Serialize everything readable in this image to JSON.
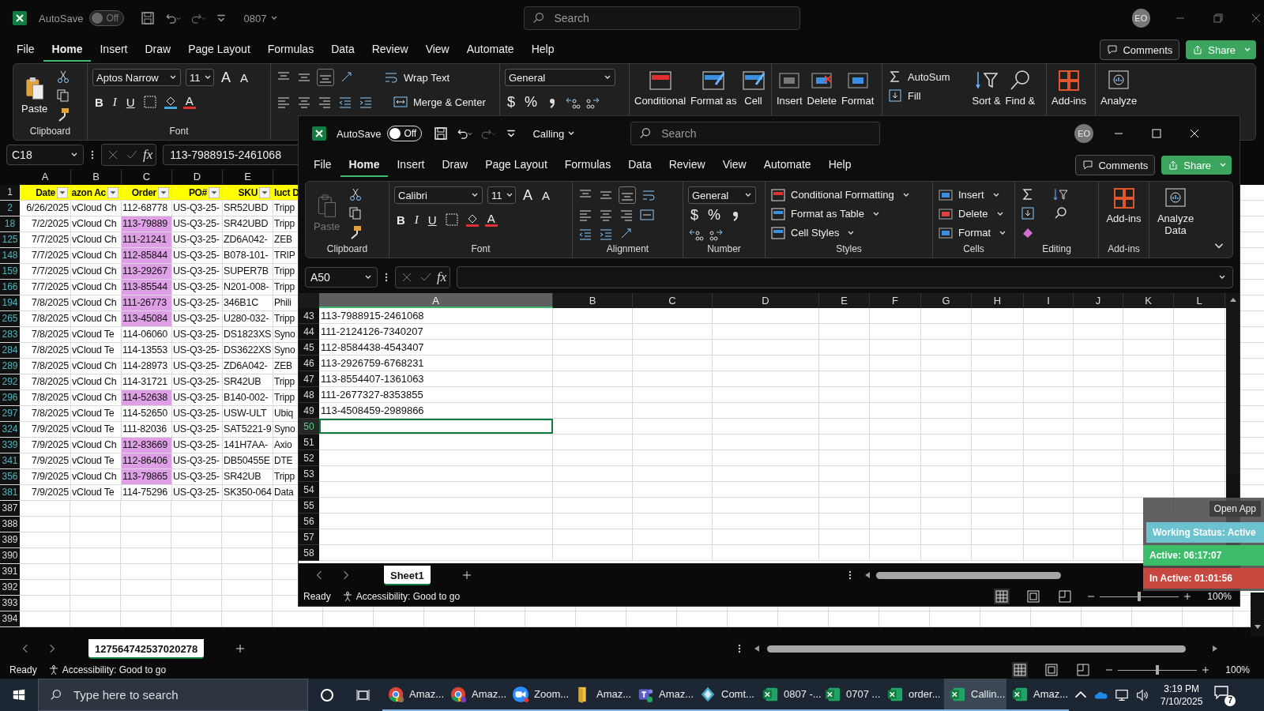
{
  "back_window": {
    "title_bar": {
      "autosave_label": "AutoSave",
      "autosave_on": false,
      "autosave_state": "Off",
      "file_name": "0807",
      "search_placeholder": "Search",
      "avatar": "EO"
    },
    "menu_tabs": [
      {
        "label": "File",
        "selected": false
      },
      {
        "label": "Home",
        "selected": true
      },
      {
        "label": "Insert",
        "selected": false
      },
      {
        "label": "Draw",
        "selected": false
      },
      {
        "label": "Page Layout",
        "selected": false
      },
      {
        "label": "Formulas",
        "selected": false
      },
      {
        "label": "Data",
        "selected": false
      },
      {
        "label": "Review",
        "selected": false
      },
      {
        "label": "View",
        "selected": false
      },
      {
        "label": "Automate",
        "selected": false
      },
      {
        "label": "Help",
        "selected": false
      }
    ],
    "comments": "Comments",
    "share": "Share",
    "ribbon": {
      "paste": "Paste",
      "clipboard_label": "Clipboard",
      "font_name": "Aptos Narrow",
      "font_size": "11",
      "grow_font": "A",
      "shrink_font": "A",
      "bold": "B",
      "italic": "I",
      "underline": "U",
      "font_color": "A",
      "font_label": "Font",
      "wrap_text": "Wrap Text",
      "merge_center": "Merge & Center",
      "number_format": "General",
      "currency": "$",
      "percent": "%",
      "styles": [
        "Conditional",
        "Format as",
        "Cell"
      ],
      "cells": [
        "Insert",
        "Delete",
        "Format"
      ],
      "autosum": "AutoSum",
      "fill": "Fill",
      "sort": "Sort &",
      "find": "Find &",
      "add_ins": "Add-ins",
      "analyze": "Analyze"
    },
    "name_box": "C18",
    "fx": "fx",
    "formula": "113-7988915-2461068",
    "columns": [
      "A",
      "B",
      "C",
      "D",
      "E"
    ],
    "header_row": {
      "number": "1",
      "cells": [
        "Date",
        "azon Ac",
        "Order",
        "PO#",
        "SKU",
        "luct D"
      ]
    },
    "rows": [
      {
        "number": "2",
        "filtered": true,
        "highlighted": false,
        "cells": [
          "6/26/2025",
          "vCloud Ch",
          "112-68778",
          "US-Q3-25-",
          "SR52UBD",
          "Tripp"
        ]
      },
      {
        "number": "18",
        "filtered": true,
        "highlighted": true,
        "cells": [
          "7/2/2025",
          "vCloud Ch",
          "113-79889",
          "US-Q3-25-",
          "SR42UBD",
          "Tripp"
        ]
      },
      {
        "number": "125",
        "filtered": true,
        "highlighted": true,
        "cells": [
          "7/7/2025",
          "vCloud Ch",
          "111-21241",
          "US-Q3-25-",
          "ZD6A042-",
          "ZEB"
        ]
      },
      {
        "number": "148",
        "filtered": true,
        "highlighted": true,
        "cells": [
          "7/7/2025",
          "vCloud Ch",
          "112-85844",
          "US-Q3-25-",
          "B078-101-",
          "TRIP"
        ]
      },
      {
        "number": "159",
        "filtered": true,
        "highlighted": true,
        "cells": [
          "7/7/2025",
          "vCloud Ch",
          "113-29267",
          "US-Q3-25-",
          "SUPER7B",
          "Tripp"
        ]
      },
      {
        "number": "166",
        "filtered": true,
        "highlighted": true,
        "cells": [
          "7/7/2025",
          "vCloud Ch",
          "113-85544",
          "US-Q3-25-",
          "N201-008-",
          "Tripp"
        ]
      },
      {
        "number": "194",
        "filtered": true,
        "highlighted": true,
        "cells": [
          "7/8/2025",
          "vCloud Ch",
          "111-26773",
          "US-Q3-25-",
          "346B1C",
          "Phili"
        ]
      },
      {
        "number": "265",
        "filtered": true,
        "highlighted": true,
        "cells": [
          "7/8/2025",
          "vCloud Ch",
          "113-45084",
          "US-Q3-25-",
          "U280-032-",
          "Tripp"
        ]
      },
      {
        "number": "283",
        "filtered": true,
        "highlighted": false,
        "cells": [
          "7/8/2025",
          "vCloud Te",
          "114-06060",
          "US-Q3-25-",
          "DS1823XS",
          "Syno"
        ]
      },
      {
        "number": "284",
        "filtered": true,
        "highlighted": false,
        "cells": [
          "7/8/2025",
          "vCloud Te",
          "114-13553",
          "US-Q3-25-",
          "DS3622XS",
          "Syno"
        ]
      },
      {
        "number": "289",
        "filtered": true,
        "highlighted": false,
        "cells": [
          "7/8/2025",
          "vCloud Ch",
          "114-28973",
          "US-Q3-25-",
          "ZD6A042-",
          "ZEB"
        ]
      },
      {
        "number": "292",
        "filtered": true,
        "highlighted": false,
        "cells": [
          "7/8/2025",
          "vCloud Ch",
          "114-31721",
          "US-Q3-25-",
          "SR42UB",
          "Tripp"
        ]
      },
      {
        "number": "296",
        "filtered": true,
        "highlighted": true,
        "cells": [
          "7/8/2025",
          "vCloud Ch",
          "114-52638",
          "US-Q3-25-",
          "B140-002-",
          "Tripp"
        ]
      },
      {
        "number": "297",
        "filtered": true,
        "highlighted": false,
        "cells": [
          "7/8/2025",
          "vCloud Te",
          "114-52650",
          "US-Q3-25-",
          "USW-ULT",
          "Ubiq"
        ]
      },
      {
        "number": "324",
        "filtered": true,
        "highlighted": false,
        "cells": [
          "7/9/2025",
          "vCloud Te",
          "111-82036",
          "US-Q3-25-",
          "SAT5221-9",
          "Syno"
        ]
      },
      {
        "number": "339",
        "filtered": true,
        "highlighted": true,
        "cells": [
          "7/9/2025",
          "vCloud Ch",
          "112-83669",
          "US-Q3-25-",
          "141H7AA-",
          "Axio"
        ]
      },
      {
        "number": "341",
        "filtered": true,
        "highlighted": true,
        "cells": [
          "7/9/2025",
          "vCloud Te",
          "112-86406",
          "US-Q3-25-",
          "DB50455E",
          "DTE"
        ]
      },
      {
        "number": "356",
        "filtered": true,
        "highlighted": true,
        "cells": [
          "7/9/2025",
          "vCloud Ch",
          "113-79865",
          "US-Q3-25-",
          "SR42UB",
          "Tripp"
        ]
      },
      {
        "number": "381",
        "filtered": true,
        "highlighted": false,
        "cells": [
          "7/9/2025",
          "vCloud Te",
          "114-75296",
          "US-Q3-25-",
          "SK350-064",
          "Data"
        ]
      },
      {
        "number": "387",
        "filtered": false
      },
      {
        "number": "388",
        "filtered": false
      },
      {
        "number": "389",
        "filtered": false
      },
      {
        "number": "390",
        "filtered": false
      },
      {
        "number": "391",
        "filtered": false
      },
      {
        "number": "392",
        "filtered": false
      },
      {
        "number": "393",
        "filtered": false
      },
      {
        "number": "394",
        "filtered": false
      }
    ],
    "sheet_tab": "127564742537020278",
    "status": "Ready",
    "accessibility": "Accessibility: Good to go",
    "zoom_slider": {
      "level": 0.5
    },
    "zoom": "100%"
  },
  "front_window": {
    "title_bar": {
      "autosave_label": "AutoSave",
      "autosave_on": false,
      "autosave_state": "Off",
      "file_name": "Calling",
      "search_placeholder": "Search",
      "avatar": "EO"
    },
    "menu_tabs": [
      {
        "label": "File",
        "selected": false
      },
      {
        "label": "Home",
        "selected": true
      },
      {
        "label": "Insert",
        "selected": false
      },
      {
        "label": "Draw",
        "selected": false
      },
      {
        "label": "Page Layout",
        "selected": false
      },
      {
        "label": "Formulas",
        "selected": false
      },
      {
        "label": "Data",
        "selected": false
      },
      {
        "label": "Review",
        "selected": false
      },
      {
        "label": "View",
        "selected": false
      },
      {
        "label": "Automate",
        "selected": false
      },
      {
        "label": "Help",
        "selected": false
      }
    ],
    "comments": "Comments",
    "share": "Share",
    "ribbon": {
      "paste": "Paste",
      "paste_disabled": true,
      "clipboard_label": "Clipboard",
      "font_name": "Calibri",
      "font_size": "11",
      "grow_font": "A",
      "shrink_font": "A",
      "bold": "B",
      "italic": "I",
      "underline": "U",
      "font_color": "A",
      "font_label": "Font",
      "alignment_label": "Alignment",
      "number_format": "General",
      "currency": "$",
      "percent": "%",
      "number_label": "Number",
      "styles": [
        "Conditional Formatting",
        "Format as Table",
        "Cell Styles"
      ],
      "styles_label": "Styles",
      "cells": [
        "Insert",
        "Delete",
        "Format"
      ],
      "cells_label": "Cells",
      "editing_label": "Editing",
      "add_ins": "Add-ins",
      "add_ins_label": "Add-ins",
      "analyze": "Analyze Data"
    },
    "name_box": "A50",
    "fx": "fx",
    "columns": [
      {
        "label": "A",
        "selected": true
      },
      {
        "label": "B",
        "selected": false
      },
      {
        "label": "C",
        "selected": false
      },
      {
        "label": "D",
        "selected": false
      },
      {
        "label": "E",
        "selected": false
      },
      {
        "label": "F",
        "selected": false
      },
      {
        "label": "G",
        "selected": false
      },
      {
        "label": "H",
        "selected": false
      },
      {
        "label": "I",
        "selected": false
      },
      {
        "label": "J",
        "selected": false
      },
      {
        "label": "K",
        "selected": false
      },
      {
        "label": "L",
        "selected": false
      }
    ],
    "rows": [
      {
        "number": "43",
        "selected": false,
        "value": "113-7988915-2461068"
      },
      {
        "number": "44",
        "selected": false,
        "value": "111-2124126-7340207"
      },
      {
        "number": "45",
        "selected": false,
        "value": "112-8584438-4543407"
      },
      {
        "number": "46",
        "selected": false,
        "value": "113-2926759-6768231"
      },
      {
        "number": "47",
        "selected": false,
        "value": "113-8554407-1361063"
      },
      {
        "number": "48",
        "selected": false,
        "value": "111-2677327-8353855"
      },
      {
        "number": "49",
        "selected": false,
        "value": "113-4508459-2989866"
      },
      {
        "number": "50",
        "selected": true
      },
      {
        "number": "51",
        "selected": false
      },
      {
        "number": "52",
        "selected": false
      },
      {
        "number": "53",
        "selected": false
      },
      {
        "number": "54",
        "selected": false
      },
      {
        "number": "55",
        "selected": false
      },
      {
        "number": "56",
        "selected": false
      },
      {
        "number": "57",
        "selected": false
      },
      {
        "number": "58",
        "selected": false
      }
    ],
    "sheet_tab": "Sheet1",
    "status": "Ready",
    "accessibility": "Accessibility: Good to go",
    "zoom_slider": {
      "level": 0.5
    },
    "zoom": "100%"
  },
  "tracker": {
    "open_app": "Open App",
    "items": [
      {
        "text": "Working Status: Active",
        "color": "#6cc3cf"
      },
      {
        "text": "Active: 06:17:07",
        "color": "#3dbd6a"
      },
      {
        "text": "In Active: 01:01:56",
        "color": "#c8473f"
      }
    ]
  },
  "taskbar": {
    "search_placeholder": "Type here to search",
    "apps": [
      {
        "kind": "chrome",
        "label": "Amaz...",
        "selected": false
      },
      {
        "kind": "chrome",
        "label": "Amaz...",
        "selected": false
      },
      {
        "kind": "zoom",
        "label": "Zoom...",
        "selected": false
      },
      {
        "kind": "folder",
        "label": "Amaz...",
        "selected": false
      },
      {
        "kind": "teams",
        "label": "Amaz...",
        "selected": false
      },
      {
        "kind": "diamond",
        "label": "Comt...",
        "selected": false
      },
      {
        "kind": "excel",
        "label": "0807 -...",
        "selected": false
      },
      {
        "kind": "excel",
        "label": "0707 ...",
        "selected": false
      },
      {
        "kind": "excel",
        "label": "order...",
        "selected": false
      },
      {
        "kind": "excel",
        "label": "Callin...",
        "selected": true
      },
      {
        "kind": "excel",
        "label": "Amaz...",
        "selected": false
      }
    ],
    "time": "3:19 PM",
    "date": "7/10/2025",
    "notifications": "7"
  }
}
